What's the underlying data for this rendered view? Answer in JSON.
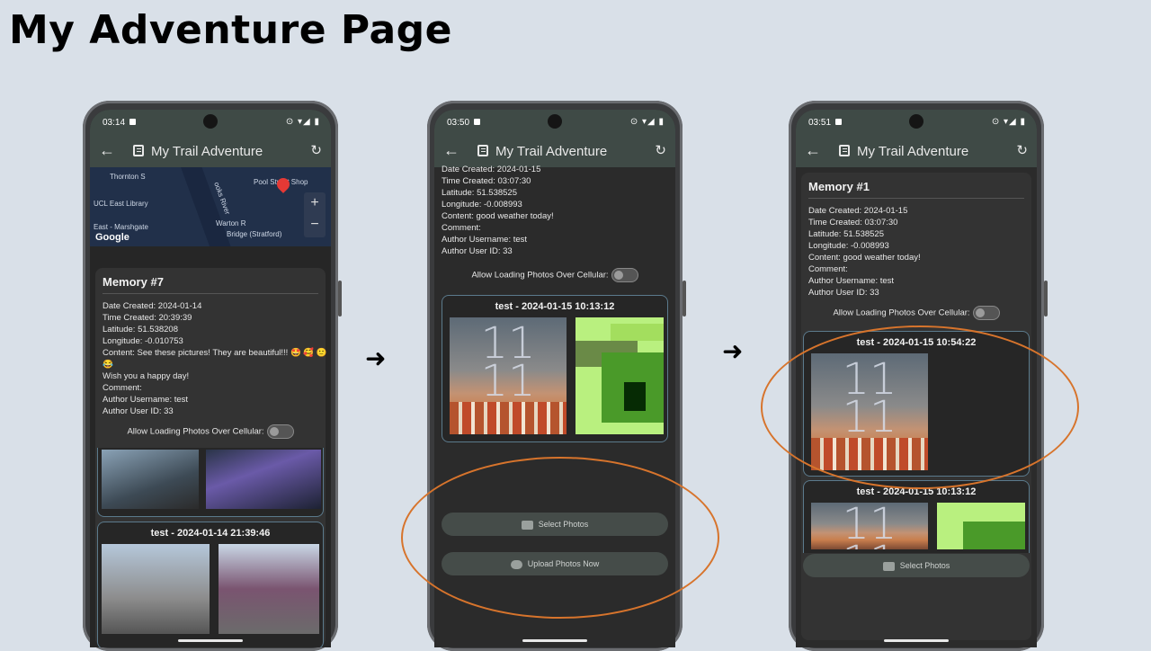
{
  "page_title": "My Adventure Page",
  "app_title": "My Trail Adventure",
  "arrows": [
    "➜",
    "➜"
  ],
  "phones": [
    {
      "time": "03:14",
      "map": {
        "labels": [
          "Thornton S",
          "UCL East Library",
          "East - Marshgate",
          "Pool Street Shop",
          "Warton R",
          "Bridge (Stratford)",
          "ooks River"
        ],
        "google": "Google"
      },
      "memory": {
        "title": "Memory #7",
        "lines": [
          "Date Created: 2024-01-14",
          "Time Created: 20:39:39",
          "Latitude: 51.538208",
          "Longitude: -0.010753",
          "Content: See these pictures! They are beautiful!!! 🤩 🥰 🙂",
          "😂",
          "Wish you a happy day!",
          "Comment:",
          "Author Username: test",
          "Author User ID: 33"
        ],
        "toggle_label": "Allow Loading Photos Over Cellular:"
      },
      "album_title": "test - 2024-01-14 21:39:46"
    },
    {
      "time": "03:50",
      "lines": [
        "Date Created: 2024-01-15",
        "Time Created: 03:07:30",
        "Latitude: 51.538525",
        "Longitude: -0.008993",
        "Content: good weather today!",
        "Comment:",
        "Author Username: test",
        "Author User ID: 33"
      ],
      "toggle_label": "Allow Loading Photos Over Cellular:",
      "album_title": "test - 2024-01-15 10:13:12",
      "select_photos": "Select Photos",
      "upload_photos": "Upload Photos Now"
    },
    {
      "time": "03:51",
      "memory": {
        "title": "Memory #1",
        "lines": [
          "Date Created: 2024-01-15",
          "Time Created: 03:07:30",
          "Latitude: 51.538525",
          "Longitude: -0.008993",
          "Content: good weather today!",
          "Comment:",
          "Author Username: test",
          "Author User ID: 33"
        ],
        "toggle_label": "Allow Loading Photos Over Cellular:"
      },
      "album_title_1": "test - 2024-01-15 10:54:22",
      "album_title_2": "test - 2024-01-15 10:13:12",
      "select_photos": "Select Photos"
    }
  ],
  "photo_text": "11\n11",
  "colors": {
    "highlight": "#d7742c",
    "card_border": "#5b7a8c",
    "appbar": "#3f4a46"
  }
}
